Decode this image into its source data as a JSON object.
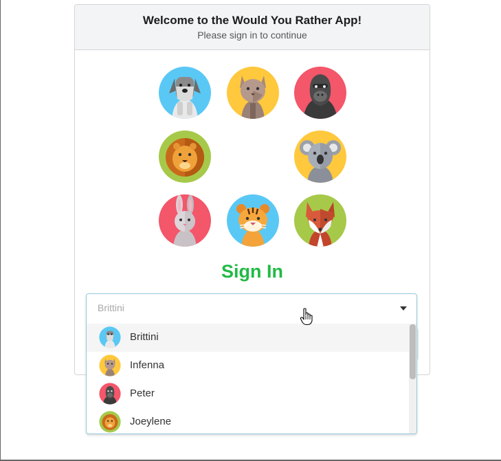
{
  "header": {
    "title": "Welcome to the Would You Rather App!",
    "subtitle": "Please sign in to continue"
  },
  "avatars": [
    {
      "name": "schnauzer-avatar",
      "bg": "#5ac8f5"
    },
    {
      "name": "cat-avatar",
      "bg": "#ffc83d"
    },
    {
      "name": "gorilla-avatar",
      "bg": "#f4566a"
    },
    {
      "name": "lion-avatar",
      "bg": "#a6c94a"
    },
    {
      "name": "koala-avatar",
      "bg": "#ffc83d"
    },
    {
      "name": "rabbit-avatar",
      "bg": "#f4566a"
    },
    {
      "name": "tiger-avatar",
      "bg": "#5ac8f5"
    },
    {
      "name": "fox-avatar",
      "bg": "#a6c94a"
    }
  ],
  "signin": {
    "heading": "Sign In",
    "accent_color": "#21ba45"
  },
  "user_select": {
    "current_value": "Brittini",
    "options": [
      {
        "label": "Brittini",
        "icon": "schnauzer-avatar"
      },
      {
        "label": "Infenna",
        "icon": "cat-avatar"
      },
      {
        "label": "Peter",
        "icon": "gorilla-avatar"
      },
      {
        "label": "Joeylene",
        "icon": "lion-avatar"
      }
    ],
    "cursor_icon": "hand-pointer-icon"
  }
}
